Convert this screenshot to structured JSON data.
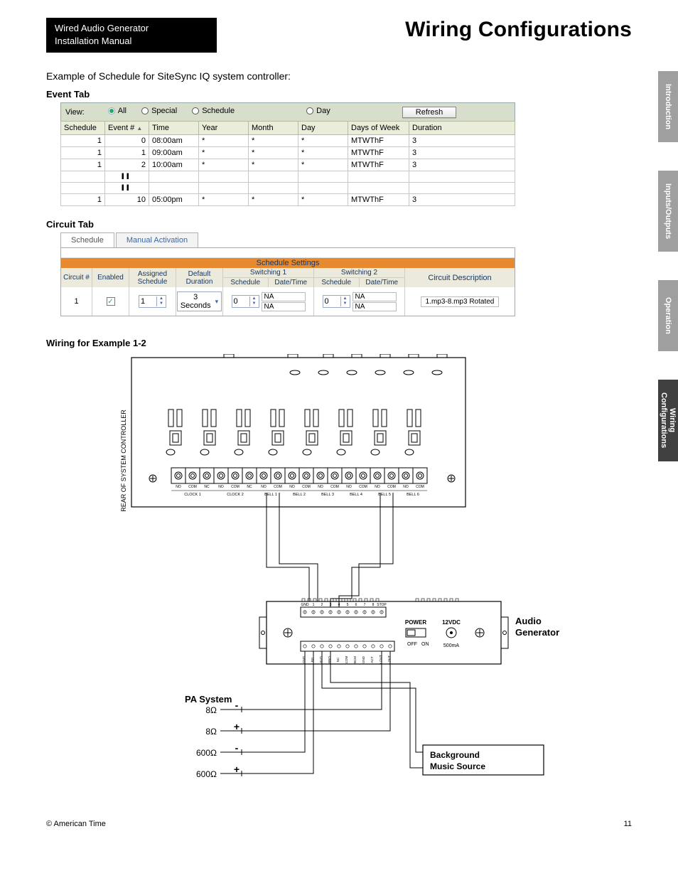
{
  "header": {
    "manual_line1": "Wired Audio Generator",
    "manual_line2": "Installation Manual",
    "title": "Wiring Configurations"
  },
  "intro": "Example of Schedule for SiteSync IQ system controller:",
  "sections": {
    "event_tab": "Event Tab",
    "circuit_tab": "Circuit Tab",
    "wiring_example": "Wiring for Example 1-2"
  },
  "side_tabs": [
    "Introduction",
    "Inputs/Outputs",
    "Operation",
    "Wiring Configurations"
  ],
  "event_filter": {
    "view_label": "View:",
    "options": [
      "All",
      "Special",
      "Schedule",
      "Day"
    ],
    "selected": "All",
    "refresh": "Refresh"
  },
  "event_columns": [
    "Schedule",
    "Event #",
    "Time",
    "Year",
    "Month",
    "Day",
    "Days of Week",
    "Duration"
  ],
  "event_rows": [
    {
      "schedule": "1",
      "event": "0",
      "time": "08:00am",
      "year": "*",
      "month": "*",
      "day": "*",
      "dow": "MTWThF",
      "dur": "3"
    },
    {
      "schedule": "1",
      "event": "1",
      "time": "09:00am",
      "year": "*",
      "month": "*",
      "day": "*",
      "dow": "MTWThF",
      "dur": "3"
    },
    {
      "schedule": "1",
      "event": "2",
      "time": "10:00am",
      "year": "*",
      "month": "*",
      "day": "*",
      "dow": "MTWThF",
      "dur": "3"
    },
    {
      "schedule": "1",
      "event": "10",
      "time": "05:00pm",
      "year": "*",
      "month": "*",
      "day": "*",
      "dow": "MTWThF",
      "dur": "3"
    }
  ],
  "circuit": {
    "tabs": [
      "Schedule",
      "Manual Activation"
    ],
    "active_tab": "Schedule",
    "settings_title": "Schedule Settings",
    "headers": {
      "num": "Circuit #",
      "enabled": "Enabled",
      "assigned": "Assigned Schedule",
      "default_dur": "Default Duration",
      "sw1": "Switching 1",
      "sw2": "Switching 2",
      "sched": "Schedule",
      "datetime": "Date/Time",
      "desc": "Circuit Description"
    },
    "row": {
      "num": "1",
      "enabled": true,
      "assigned": "1",
      "default_dur": "3 Seconds",
      "sw1_sched": "0",
      "sw1_dt1": "NA",
      "sw1_dt2": "NA",
      "sw2_sched": "0",
      "sw2_dt1": "NA",
      "sw2_dt2": "NA",
      "desc": "1.mp3-8.mp3 Rotated"
    }
  },
  "diagram": {
    "rear_label": "REAR OF SYSTEM CONTROLLER",
    "clock_block_labels": [
      "NO",
      "COM",
      "NC",
      "NO",
      "COM",
      "NC",
      "NO",
      "COM",
      "NO",
      "COM",
      "NO",
      "COM",
      "NO",
      "COM",
      "NO",
      "COM",
      "NO",
      "COM"
    ],
    "clock_groups": [
      "CLOCK 1",
      "CLOCK 2",
      "BELL 1",
      "BELL 2",
      "BELL 3",
      "BELL 4",
      "BELL 5",
      "BELL 6"
    ],
    "audio_gen": "Audio Generator",
    "pa_system": "PA System",
    "bg_music": "Background Music Source",
    "power": "POWER",
    "vdc": "12VDC",
    "off": "OFF",
    "on": "ON",
    "ma": "500mA",
    "audio_top_pins": [
      "GND",
      "1",
      "2",
      "3",
      "4",
      "5",
      "6",
      "7",
      "8",
      "STOP"
    ],
    "audio_bot_pins": [
      "GND",
      "BG",
      "AUD",
      "BNO",
      "NC",
      "COM",
      "BCM",
      "GND",
      "ACT",
      "+ OUT",
      "- OUT"
    ],
    "pa_rows": [
      "8Ω",
      "8Ω",
      "600Ω",
      "600Ω"
    ],
    "pa_signs": [
      "-",
      "+",
      "-",
      "+"
    ]
  },
  "footer": {
    "copyright": "© American Time",
    "page": "11"
  }
}
